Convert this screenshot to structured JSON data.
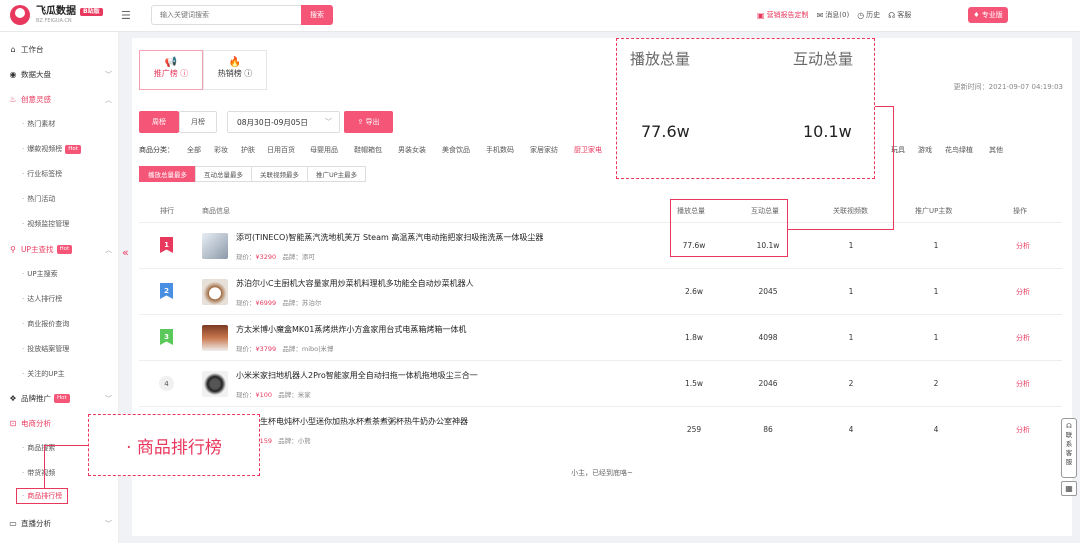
{
  "app": {
    "name": "飞瓜数据",
    "badge": "B站版",
    "domain": "BZ.FEIGUA.CN"
  },
  "header": {
    "search_placeholder": "输入关键词搜索",
    "search_btn": "搜索",
    "actions": [
      {
        "icon": "report-icon",
        "glyph": "▣",
        "label": "营销报告定制"
      },
      {
        "icon": "message-icon",
        "glyph": "✉",
        "label": "消息(0)"
      },
      {
        "icon": "history-icon",
        "glyph": "◷",
        "label": "历史"
      },
      {
        "icon": "support-icon",
        "glyph": "☊",
        "label": "客服"
      }
    ],
    "pro": "专业版"
  },
  "sidebar": {
    "workbench": "工作台",
    "dashboard": "数据大盘",
    "creative": "创意灵感",
    "creative_sub": [
      "热门素材",
      "爆款视频榜",
      "行业标签榜",
      "热门活动",
      "视频监控管理"
    ],
    "creative_hot_index": 1,
    "up": "UP主查找",
    "up_sub": [
      "UP主搜索",
      "达人排行榜",
      "商业报价查询",
      "投放结案管理",
      "关注的UP主"
    ],
    "brand": "品牌推广",
    "ecommerce": "电商分析",
    "ecommerce_sub": [
      "商品搜索",
      "带货视频",
      "商品排行榜"
    ],
    "live": "直播分析",
    "hot": "Hot"
  },
  "main": {
    "tabs": [
      {
        "label": "推广榜"
      },
      {
        "label": "热销榜"
      }
    ],
    "update_time": "更新时间：2021-09-07 04:19:03",
    "period": {
      "week": "周榜",
      "month": "月榜",
      "date_range": "08月30日-09月05日"
    },
    "export": "导出",
    "category_label": "商品分类：",
    "categories": [
      "全部",
      "彩妆",
      "护肤",
      "日用百货",
      "母婴用品",
      "鞋帽箱包",
      "男装女装",
      "美食饮品",
      "手机数码",
      "家居家纺",
      "厨卫家电",
      "玩具",
      "游戏",
      "花鸟绿植",
      "其他"
    ],
    "selected_category": "厨卫家电",
    "sort_tabs": [
      "播放总量最多",
      "互动总量最多",
      "关联视频最多",
      "推广UP主最多"
    ],
    "columns": [
      "排行",
      "商品信息",
      "播放总量",
      "互动总量",
      "关联视频数",
      "推广UP主数",
      "操作"
    ],
    "price_label": "现价：",
    "brand_label": "品牌：",
    "rows": [
      {
        "rank": "1",
        "name": "添可(TINECO)智能蒸汽洗地机芙万 Steam 高温蒸汽电动拖把家扫吸拖洗蒸一体吸尘器",
        "price": "¥3290",
        "brand": "添可",
        "plays": "77.6w",
        "interactions": "10.1w",
        "videos": "1",
        "ups": "1",
        "op": "分析"
      },
      {
        "rank": "2",
        "name": "苏泊尔小C主厨机大容量家用炒菜机料理机多功能全自动炒菜机器人",
        "price": "¥6999",
        "brand": "苏泊尔",
        "plays": "2.6w",
        "interactions": "2045",
        "videos": "1",
        "ups": "1",
        "op": "分析"
      },
      {
        "rank": "3",
        "name": "方太米博小魔盒MK01蒸烤烘炸小方盒家用台式电蒸箱烤箱一体机",
        "price": "¥3799",
        "brand": "mibo|米博",
        "plays": "1.8w",
        "interactions": "4098",
        "videos": "1",
        "ups": "1",
        "op": "分析"
      },
      {
        "rank": "4",
        "name": "小米米家扫地机器人2Pro智能家用全自动扫拖一体机拖地吸尘三合一",
        "price": "¥100",
        "brand": "米家",
        "plays": "1.5w",
        "interactions": "2046",
        "videos": "2",
        "ups": "2",
        "op": "分析"
      },
      {
        "rank": "5",
        "name": "小熊养生杯电炖杯小型迷你加热水杯煮茶煮粥杯热牛奶办公室神器",
        "price": "¥159",
        "brand": "小熊",
        "plays": "259",
        "interactions": "86",
        "videos": "4",
        "ups": "4",
        "op": "分析"
      }
    ],
    "end_text": "小主，已经到底咯~"
  },
  "zoom": {
    "plays_label": "播放总量",
    "interactions_label": "互动总量",
    "plays_value": "77.6w",
    "interactions_value": "10.1w"
  },
  "callout": "· 商品排行榜",
  "float": {
    "contact": "联系客服"
  },
  "colors": {
    "accent": "#e8385d",
    "accent_light": "#f55577"
  }
}
